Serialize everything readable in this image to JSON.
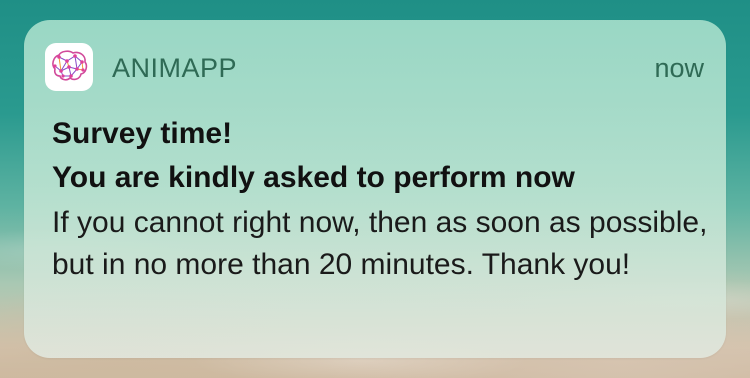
{
  "notification": {
    "app_name": "ANIMAPP",
    "timestamp": "now",
    "title": "Survey time!",
    "subtitle": "You are kindly asked to perform now",
    "body": "If you cannot right now, then as soon as possible, but in no more than 20 minutes. Thank you!"
  },
  "icons": {
    "app_icon": "brain-network-icon"
  },
  "colors": {
    "header_text": "#2f6a55",
    "title_text": "#111111",
    "body_text": "#1a1a1a",
    "brain_pink": "#e0409a",
    "brain_purple": "#8a4bc8",
    "brain_orange": "#f29a3a"
  }
}
